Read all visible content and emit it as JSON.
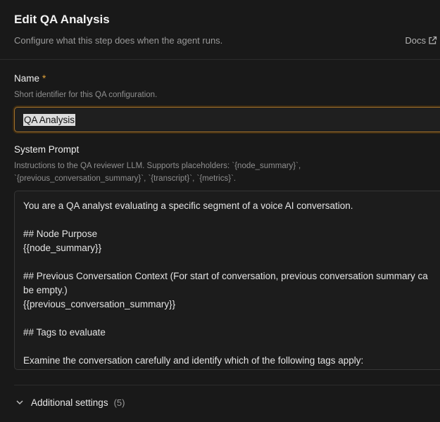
{
  "header": {
    "title": "Edit QA Analysis",
    "subtitle": "Configure what this step does when the agent runs.",
    "docs_label": "Docs"
  },
  "name_field": {
    "label": "Name",
    "required_marker": "*",
    "help": "Short identifier for this QA configuration.",
    "value": "QA Analysis"
  },
  "system_prompt": {
    "label": "System Prompt",
    "help_line1": "Instructions to the QA reviewer LLM. Supports placeholders: `{node_summary}`,",
    "help_line2": "`{previous_conversation_summary}`, `{transcript}`, `{metrics}`.",
    "lines": [
      "You are a QA analyst evaluating a specific segment of a voice AI conversation.",
      "",
      "## Node Purpose",
      "{{node_summary}}",
      "",
      "## Previous Conversation Context (For start of conversation, previous conversation summary ca",
      "be empty.)",
      "{{previous_conversation_summary}}",
      "",
      "## Tags to evaluate",
      "",
      "Examine the conversation carefully and identify which of the following tags apply:"
    ]
  },
  "additional_settings": {
    "label": "Additional settings",
    "count": "(5)"
  },
  "colors": {
    "background": "#191919",
    "focus_border": "#a3712b",
    "required": "#e0a23a"
  },
  "icons": {
    "docs": "external-link-icon",
    "expand": "chevron-down-icon"
  }
}
